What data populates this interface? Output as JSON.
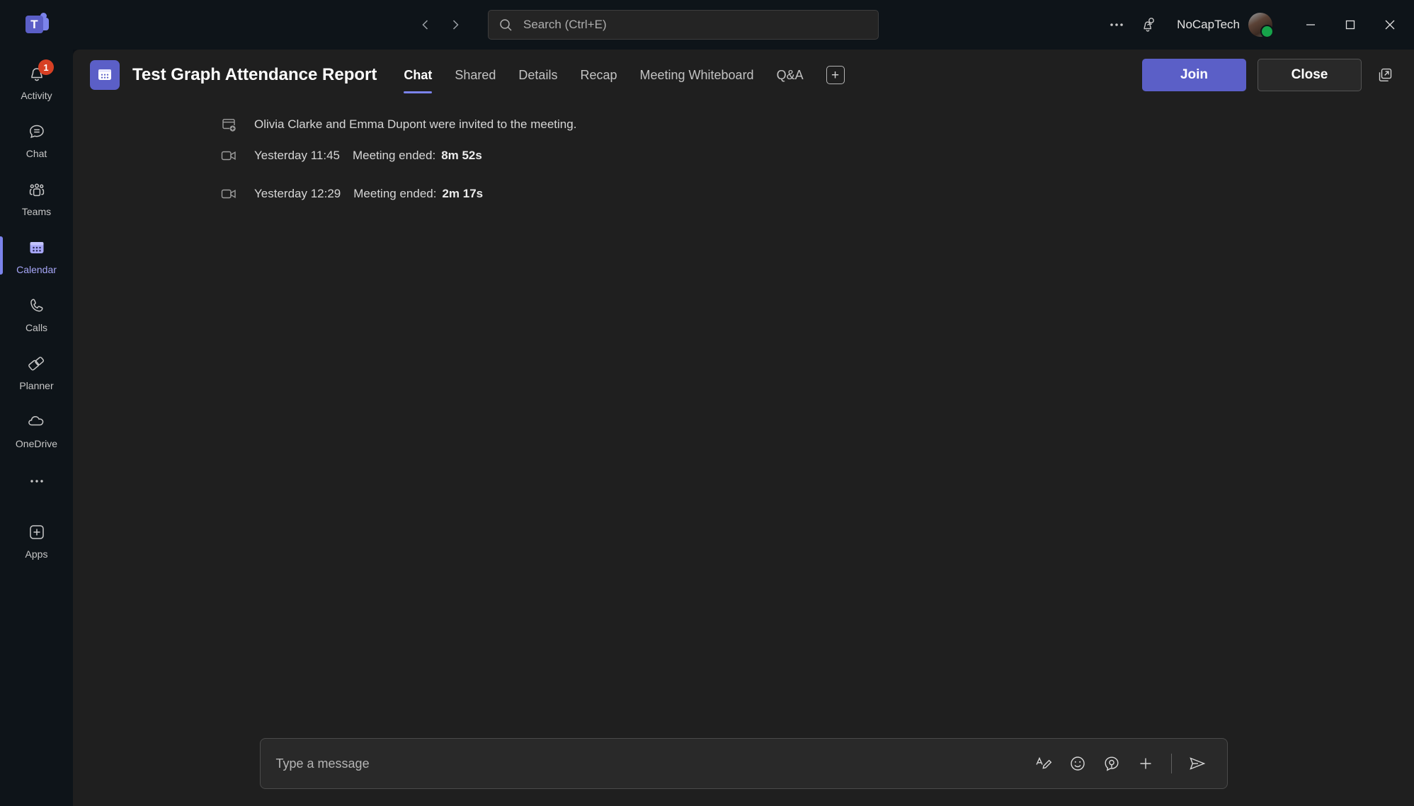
{
  "titlebar": {
    "logo_name": "teams-logo",
    "logo_letter": "T",
    "back_icon": "chevron-left-icon",
    "forward_icon": "chevron-right-icon",
    "search": {
      "placeholder": "Search (Ctrl+E)",
      "icon": "search-icon"
    },
    "more_icon": "more-options-icon",
    "notification_icon": "notification-bell-person-icon",
    "account_name": "NoCapTech",
    "avatar_name": "user-avatar",
    "presence": "available",
    "window": {
      "minimize": "minimize-icon",
      "maximize": "maximize-icon",
      "close": "close-icon"
    }
  },
  "rail": {
    "items": [
      {
        "label": "Activity",
        "icon": "activity-bell-icon",
        "badge": "1",
        "active": false
      },
      {
        "label": "Chat",
        "icon": "chat-bubble-icon",
        "badge": "",
        "active": false
      },
      {
        "label": "Teams",
        "icon": "teams-people-icon",
        "badge": "",
        "active": false
      },
      {
        "label": "Calendar",
        "icon": "calendar-icon",
        "badge": "",
        "active": true
      },
      {
        "label": "Calls",
        "icon": "phone-icon",
        "badge": "",
        "active": false
      },
      {
        "label": "Planner",
        "icon": "planner-icon",
        "badge": "",
        "active": false
      },
      {
        "label": "OneDrive",
        "icon": "cloud-icon",
        "badge": "",
        "active": false
      }
    ],
    "more_icon": "more-apps-icon",
    "apps": {
      "label": "Apps",
      "icon": "add-apps-icon"
    }
  },
  "meeting": {
    "icon": "calendar-app-icon",
    "title": "Test Graph Attendance Report",
    "tabs": [
      {
        "label": "Chat",
        "active": true
      },
      {
        "label": "Shared",
        "active": false
      },
      {
        "label": "Details",
        "active": false
      },
      {
        "label": "Recap",
        "active": false
      },
      {
        "label": "Meeting Whiteboard",
        "active": false
      },
      {
        "label": "Q&A",
        "active": false
      }
    ],
    "add_tab_icon": "add-tab-icon",
    "add_tab_glyph": "+",
    "join_label": "Join",
    "close_label": "Close",
    "popout_icon": "open-in-new-window-icon",
    "accent_color": "#5b5fc7"
  },
  "messages": [
    {
      "icon": "add-participant-icon",
      "time": "",
      "text": "Olivia Clarke and Emma Dupont were invited to the meeting.",
      "label": "",
      "value": ""
    },
    {
      "icon": "video-camera-icon",
      "time": "Yesterday 11:45",
      "text": "",
      "label": "Meeting ended:",
      "value": "8m 52s"
    },
    {
      "icon": "video-camera-icon",
      "time": "Yesterday 12:29",
      "text": "",
      "label": "Meeting ended:",
      "value": "2m 17s"
    }
  ],
  "compose": {
    "placeholder": "Type a message",
    "tools": [
      {
        "name": "format-text-icon"
      },
      {
        "name": "emoji-icon"
      },
      {
        "name": "copilot-icon"
      },
      {
        "name": "add-attachment-icon"
      }
    ],
    "send_icon": "send-icon"
  }
}
